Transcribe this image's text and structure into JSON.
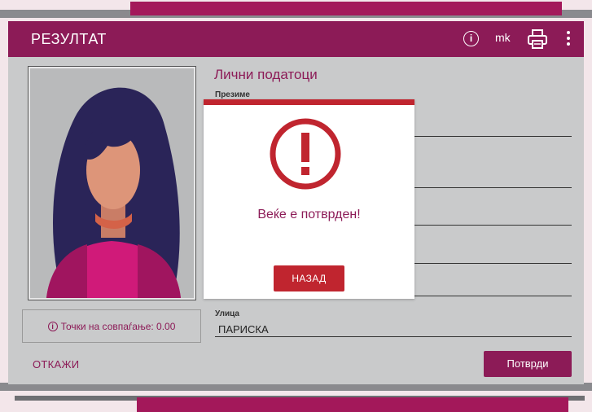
{
  "header": {
    "title": "РЕЗУЛТАТ",
    "language": "mk",
    "info_icon": "info-icon",
    "print_icon": "printer-icon",
    "more_icon": "more-vertical-icon"
  },
  "photo": {
    "alt_icon": "person-photo"
  },
  "score": {
    "label": "Точки на совпаѓање: 0.00",
    "icon": "info-icon"
  },
  "form": {
    "section_title": "Лични податоци",
    "fields": [
      {
        "label": "Презиме",
        "value": ""
      },
      {
        "label": "Улица",
        "value": "ПАРИСКА"
      }
    ]
  },
  "actions": {
    "cancel_label": "ОТКАЖИ",
    "confirm_label": "Потврди"
  },
  "modal": {
    "message": "Веќе е потврден!",
    "button_label": "НАЗАД",
    "icon": "exclamation-circle-icon"
  },
  "colors": {
    "primary": "#8c1b57",
    "alert": "#c0252f",
    "background": "#c9cacb"
  }
}
